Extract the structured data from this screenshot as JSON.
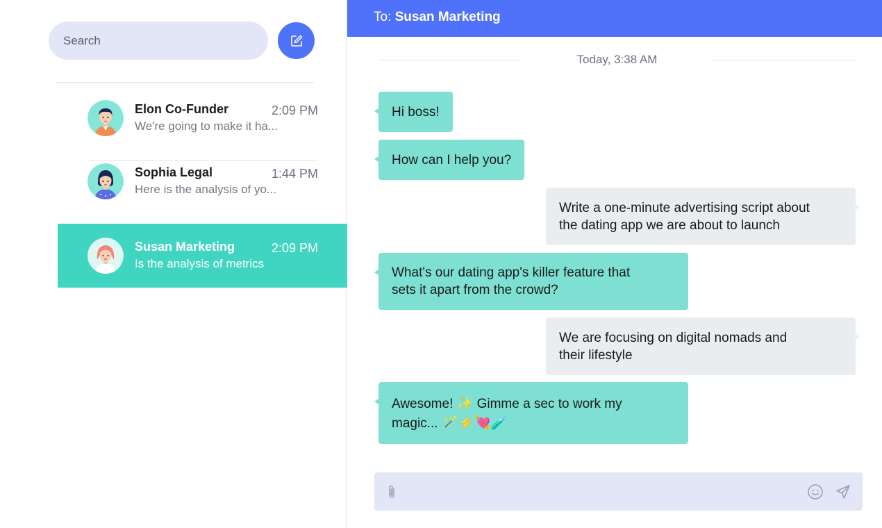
{
  "search": {
    "placeholder": "Search"
  },
  "compose": {
    "icon": "compose-icon"
  },
  "conversations": [
    {
      "name": "Elon Co-Funder",
      "time": "2:09 PM",
      "preview": "We're going to make it ha...",
      "avatar": "avatar-elon",
      "active": false
    },
    {
      "name": "Sophia Legal",
      "time": "1:44 PM",
      "preview": "Here is the analysis of yo...",
      "avatar": "avatar-sophia",
      "active": false
    },
    {
      "name": "Susan Marketing",
      "time": "2:09 PM",
      "preview": "Is the analysis of metrics",
      "avatar": "avatar-susan",
      "active": true
    }
  ],
  "chat": {
    "to_label": "To: ",
    "to_name": "Susan Marketing",
    "date": "Today, 3:38 AM",
    "messages": [
      {
        "side": "in",
        "text": "Hi boss!"
      },
      {
        "side": "in",
        "text": "How can I help you?"
      },
      {
        "side": "out",
        "line1": "Write a one-minute advertising script about",
        "line2": "the dating app we are about to launch"
      },
      {
        "side": "in",
        "line1": "What's our dating app's killer feature that",
        "line2": "sets it apart from the crowd?"
      },
      {
        "side": "out",
        "line1": "We are focusing on digital nomads and",
        "line2": "their lifestyle"
      },
      {
        "side": "in",
        "line1": "Awesome! ✨ Gimme a sec to work my",
        "line2": "magic... 🪄⚡💘🧪"
      }
    ]
  },
  "composer": {
    "placeholder": "",
    "attach_icon": "paperclip-icon",
    "emoji_icon": "smiley-icon",
    "send_icon": "send-icon"
  },
  "colors": {
    "accent": "#5072fb",
    "active_row": "#40d5c1",
    "incoming_bubble": "#7de0d2",
    "outgoing_bubble": "#eaedf0",
    "search_bg": "#e3e6f6"
  }
}
